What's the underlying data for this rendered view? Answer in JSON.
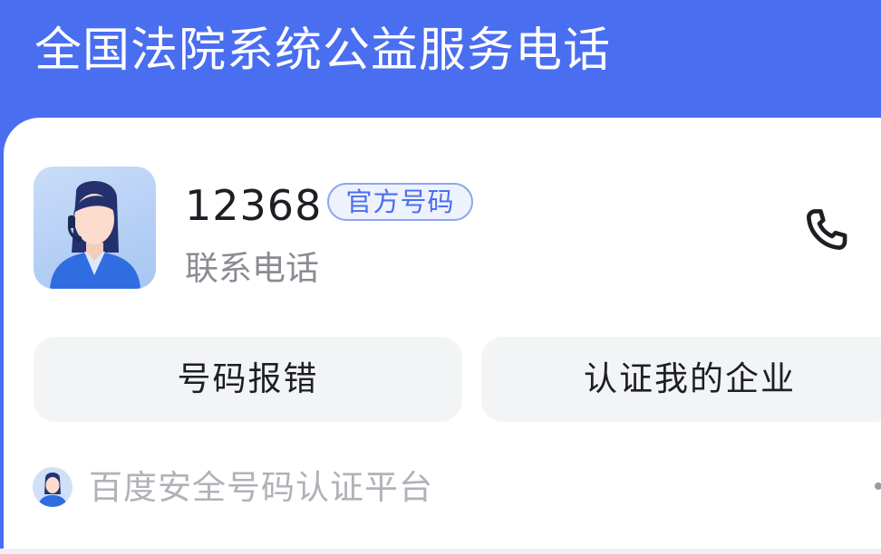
{
  "header": {
    "title": "全国法院系统公益服务电话"
  },
  "contact": {
    "number": "12368",
    "badge": "官方号码",
    "label": "联系电话"
  },
  "actions": {
    "report_label": "号码报错",
    "verify_label": "认证我的企业"
  },
  "footer": {
    "platform_label": "百度安全号码认证平台"
  },
  "colors": {
    "accent": "#4a6ef0",
    "badge_border": "#8ea6f0",
    "button_bg": "#f3f4f6",
    "muted_text": "#8a8c93"
  },
  "icons": {
    "avatar": "customer-service-agent-avatar",
    "call": "phone-icon",
    "footer": "platform-logo-icon"
  }
}
